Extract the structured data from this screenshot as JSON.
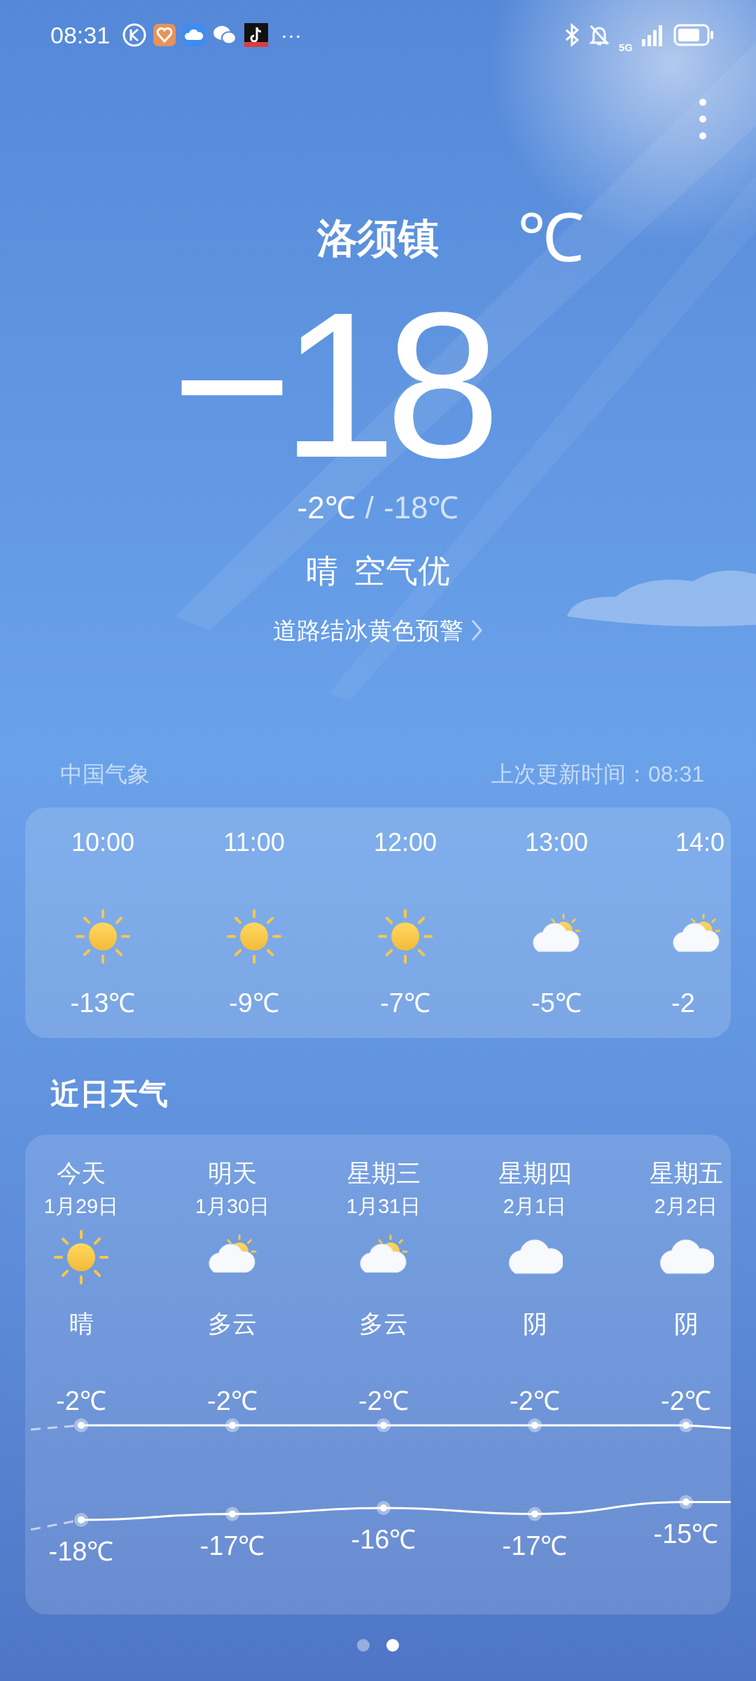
{
  "status_bar": {
    "time": "08:31",
    "more": "···",
    "network": "5G"
  },
  "current": {
    "location": "洛须镇",
    "temperature": "−18",
    "unit": "℃",
    "high": "-2℃",
    "separator": "/",
    "low": "-18℃",
    "condition": "晴",
    "air_quality": "空气优",
    "alert": "道路结冰黄色预警"
  },
  "source": {
    "provider": "中国气象",
    "updated": "上次更新时间：08:31"
  },
  "hourly": [
    {
      "time": "10:00",
      "kind": "sunny",
      "temp": "-13℃"
    },
    {
      "time": "11:00",
      "kind": "sunny",
      "temp": "-9℃"
    },
    {
      "time": "12:00",
      "kind": "sunny",
      "temp": "-7℃"
    },
    {
      "time": "13:00",
      "kind": "partly_cloudy",
      "temp": "-5℃"
    },
    {
      "time": "14:0",
      "kind": "partly_cloudy",
      "temp": "-2"
    }
  ],
  "daily_title": "近日天气",
  "daily": [
    {
      "day": "今天",
      "date": "1月29日",
      "kind": "sunny",
      "condition": "晴",
      "high": "-2℃",
      "low": "-18℃"
    },
    {
      "day": "明天",
      "date": "1月30日",
      "kind": "partly_cloudy",
      "condition": "多云",
      "high": "-2℃",
      "low": "-17℃"
    },
    {
      "day": "星期三",
      "date": "1月31日",
      "kind": "partly_cloudy",
      "condition": "多云",
      "high": "-2℃",
      "low": "-16℃"
    },
    {
      "day": "星期四",
      "date": "2月1日",
      "kind": "cloudy",
      "condition": "阴",
      "high": "-2℃",
      "low": "-17℃"
    },
    {
      "day": "星期五",
      "date": "2月2日",
      "kind": "cloudy",
      "condition": "阴",
      "high": "-2℃",
      "low": "-15℃"
    }
  ],
  "pager": [
    {
      "selected": false
    },
    {
      "selected": true
    }
  ]
}
